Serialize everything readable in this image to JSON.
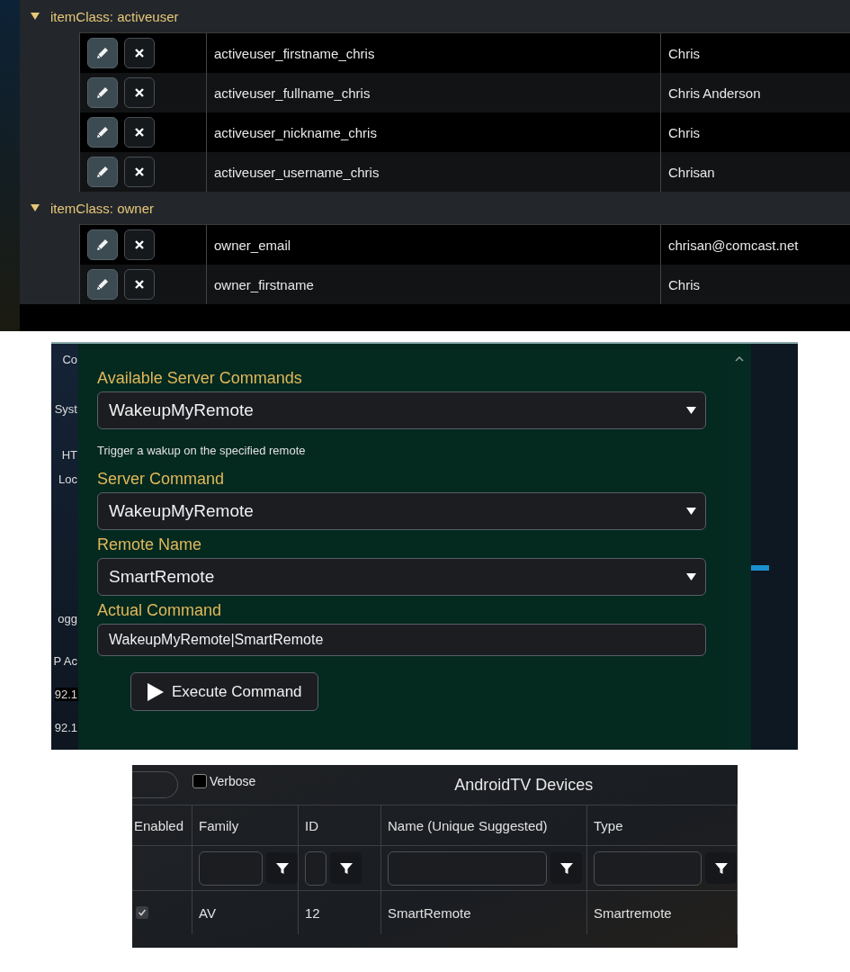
{
  "item_classes": [
    {
      "label": "itemClass: activeuser",
      "expanded": true,
      "rows": [
        {
          "key": "activeuser_firstname_chris",
          "value": "Chris"
        },
        {
          "key": "activeuser_fullname_chris",
          "value": "Chris Anderson"
        },
        {
          "key": "activeuser_nickname_chris",
          "value": "Chris"
        },
        {
          "key": "activeuser_username_chris",
          "value": "Chrisan"
        }
      ]
    },
    {
      "label": "itemClass: owner",
      "expanded": true,
      "rows": [
        {
          "key": "owner_email",
          "value": "chrisan@comcast.net"
        },
        {
          "key": "owner_firstname",
          "value": "Chris"
        }
      ]
    }
  ],
  "command_dialog": {
    "background_texts": [
      "Co",
      "Syst",
      "HT",
      "Loc",
      "ogg",
      "P Ac",
      "92.1",
      "92.1"
    ],
    "fields": [
      {
        "kind": "select",
        "label": "Available Server Commands",
        "value": "WakeupMyRemote",
        "hint": "Trigger a wakup on the specified remote"
      },
      {
        "kind": "select",
        "label": "Server Command",
        "value": "WakeupMyRemote"
      },
      {
        "kind": "select",
        "label": "Remote Name",
        "value": "SmartRemote"
      },
      {
        "kind": "text",
        "label": "Actual Command",
        "value": "WakeupMyRemote|SmartRemote"
      }
    ],
    "execute_button": "Execute Command"
  },
  "devices": {
    "verbose": {
      "label": "Verbose",
      "checked": false
    },
    "title": "AndroidTV Devices",
    "columns": [
      {
        "label": "Enabled",
        "kind": "checkbox",
        "filter": false
      },
      {
        "label": "Family",
        "kind": "text",
        "filter": true
      },
      {
        "label": "ID",
        "kind": "number",
        "filter": true
      },
      {
        "label": "Name (Unique Suggested)",
        "kind": "text",
        "filter": true
      },
      {
        "label": "Type",
        "kind": "text",
        "filter": true
      }
    ],
    "rows": [
      {
        "enabled": true,
        "cells": [
          "",
          "AV",
          "12",
          "SmartRemote",
          "Smartremote"
        ]
      }
    ]
  }
}
